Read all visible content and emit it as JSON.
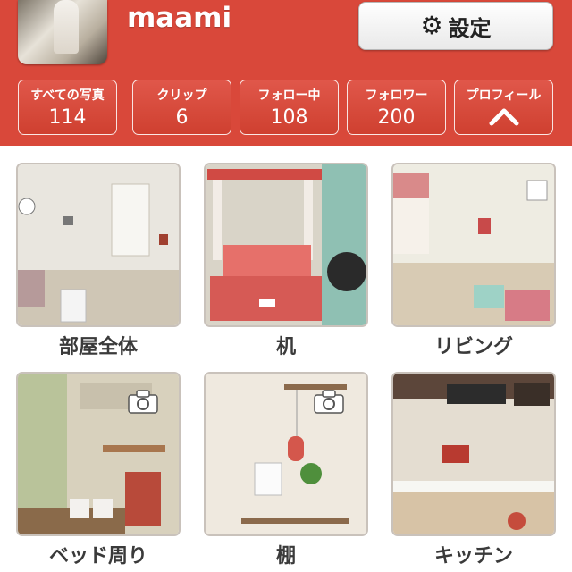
{
  "profile": {
    "username": "maami"
  },
  "settings": {
    "label": "設定",
    "icon": "gear-icon"
  },
  "stats": [
    {
      "label": "すべての写真",
      "value": "114"
    },
    {
      "label": "クリップ",
      "value": "6"
    },
    {
      "label": "フォロー中",
      "value": "108"
    },
    {
      "label": "フォロワー",
      "value": "200"
    },
    {
      "label": "プロフィール",
      "icon": "chevron-up-icon"
    }
  ],
  "albums": [
    {
      "caption": "部屋全体"
    },
    {
      "caption": "机"
    },
    {
      "caption": "リビング"
    },
    {
      "caption": "ベッド周り",
      "icon": "camera-icon"
    },
    {
      "caption": "棚",
      "icon": "camera-icon"
    },
    {
      "caption": "キッチン"
    }
  ],
  "colors": {
    "header": "#d9483a",
    "button_border": "#ffffff",
    "caption_text": "#3a3a3a"
  }
}
